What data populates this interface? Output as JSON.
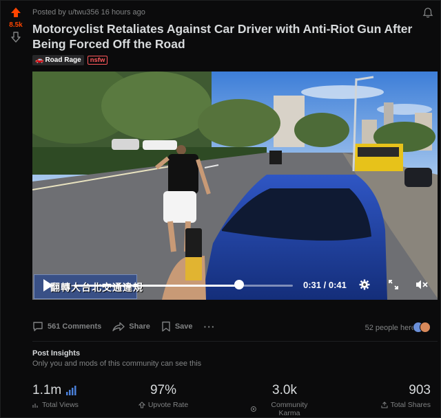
{
  "post": {
    "vote_count": "8.5k",
    "meta": "Posted by u/twu356 16 hours ago",
    "title": "Motorcyclist Retaliates Against Car Driver with Anti-Riot Gun After Being Forced Off the Road",
    "flair": "Road Rage",
    "nsfw_tag": "nsfw"
  },
  "video": {
    "subtitle": "翻轉大台北交通違規",
    "time": "0:31 / 0:41",
    "progress": 0.756
  },
  "actions": {
    "comments": "561 Comments",
    "share": "Share",
    "save": "Save",
    "more": "···",
    "people_here": "52 people here"
  },
  "insights": {
    "title": "Post Insights",
    "subtitle": "Only you and mods of this community can see this",
    "stats": [
      {
        "value": "1.1m",
        "label": "Total Views"
      },
      {
        "value": "97%",
        "label": "Upvote Rate"
      },
      {
        "value": "3.0k",
        "label": "Community Karma"
      },
      {
        "value": "903",
        "label": "Total Shares"
      }
    ]
  },
  "colors": {
    "upvote": "#ff4500",
    "background": "#0b0b0c",
    "muted_text": "#818384",
    "stats_icon": "#4a7fd8"
  },
  "icons": [
    "upvote-icon",
    "downvote-icon",
    "bell-icon",
    "play-icon",
    "gear-icon",
    "expand-icon",
    "mute-icon",
    "comment-icon",
    "share-icon",
    "bookmark-icon",
    "bar-chart-icon",
    "upvote-outline-icon",
    "karma-icon",
    "share-outline-icon"
  ]
}
